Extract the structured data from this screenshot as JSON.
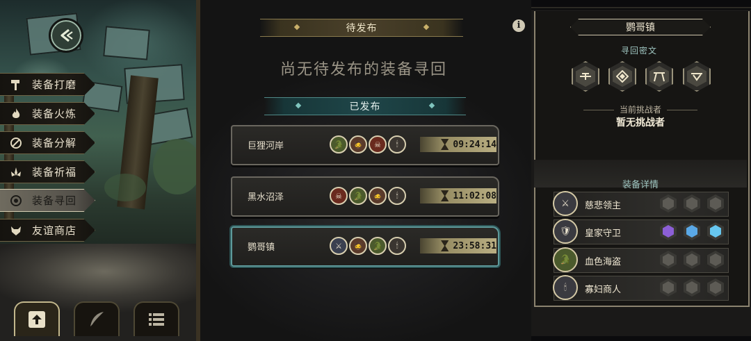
{
  "menu": {
    "items": [
      {
        "label": "装备打磨",
        "icon": "hammer-icon",
        "active": false
      },
      {
        "label": "装备火炼",
        "icon": "flame-icon",
        "active": false
      },
      {
        "label": "装备分解",
        "icon": "no-entry-icon",
        "active": false
      },
      {
        "label": "装备祈福",
        "icon": "lotus-icon",
        "active": false
      },
      {
        "label": "装备寻回",
        "icon": "target-icon",
        "active": true
      },
      {
        "label": "友谊商店",
        "icon": "fox-icon",
        "active": false
      }
    ]
  },
  "pending": {
    "title": "待发布",
    "empty_message": "尚无待发布的装备寻回"
  },
  "published": {
    "title": "已发布",
    "quests": [
      {
        "name": "巨狸河岸",
        "timer": "09:24:14",
        "selected": false
      },
      {
        "name": "黑水沼泽",
        "timer": "11:02:08",
        "selected": false
      },
      {
        "name": "鹦哥镇",
        "timer": "23:58:31",
        "selected": true
      }
    ]
  },
  "detail": {
    "location": "鹦哥镇",
    "runes_title": "寻回密文",
    "challenger_title": "当前挑战者",
    "challenger_value": "暂无挑战者",
    "equip_title": "装备详情",
    "equipment": [
      {
        "name": "慈悲领主",
        "slots": [
          "empty",
          "empty",
          "empty"
        ]
      },
      {
        "name": "皇家守卫",
        "slots": [
          "purple",
          "blue",
          "cyan"
        ]
      },
      {
        "name": "血色海盗",
        "slots": [
          "empty",
          "empty",
          "empty"
        ]
      },
      {
        "name": "寡妇商人",
        "slots": [
          "empty",
          "empty",
          "empty"
        ]
      }
    ]
  },
  "colors": {
    "accent_gold": "#b9ae82",
    "accent_teal": "#5e9a9b",
    "rarity_purple": "#8c5fd6",
    "rarity_blue": "#5aa8e6"
  }
}
